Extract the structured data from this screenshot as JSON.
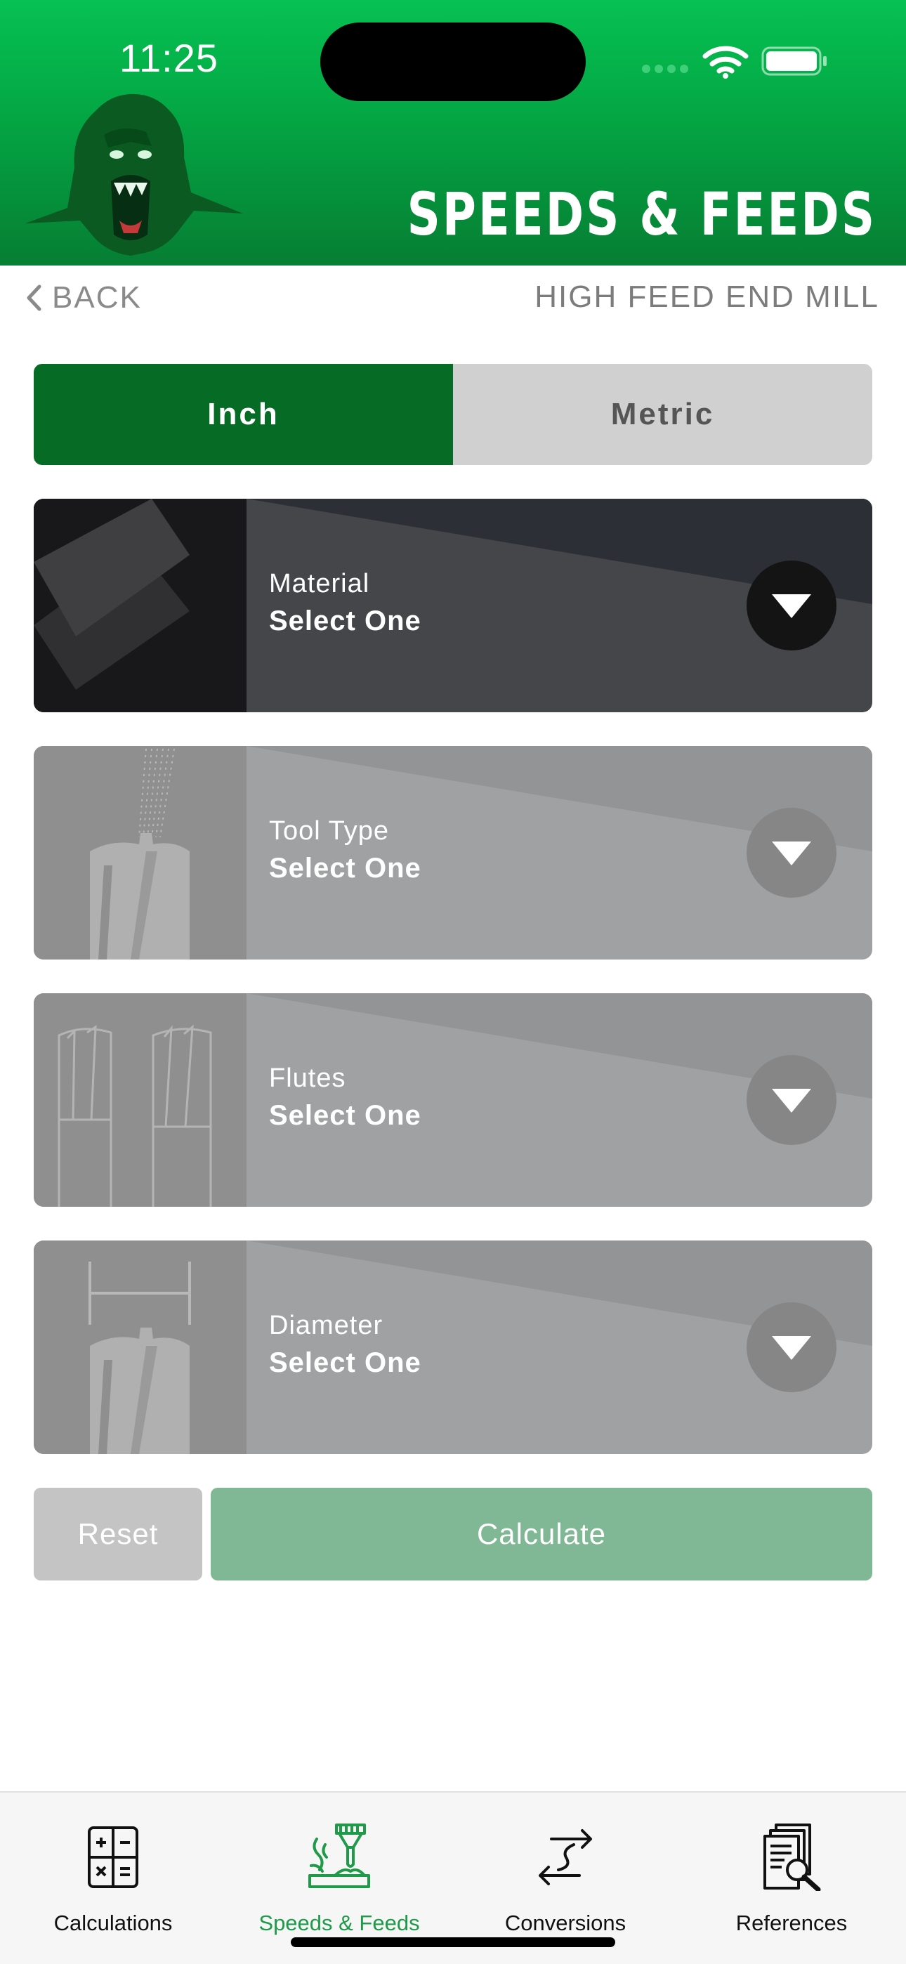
{
  "status": {
    "time": "11:25"
  },
  "header": {
    "title": "SPEEDS & FEEDS"
  },
  "nav": {
    "back_label": "BACK",
    "subtitle": "HIGH FEED END MILL"
  },
  "units": {
    "inch_label": "Inch",
    "metric_label": "Metric",
    "selected": "Inch"
  },
  "cards": [
    {
      "label": "Material",
      "value": "Select One",
      "state": "active"
    },
    {
      "label": "Tool Type",
      "value": "Select One",
      "state": "disabled"
    },
    {
      "label": "Flutes",
      "value": "Select One",
      "state": "disabled"
    },
    {
      "label": "Diameter",
      "value": "Select One",
      "state": "disabled"
    }
  ],
  "actions": {
    "reset_label": "Reset",
    "calculate_label": "Calculate"
  },
  "tabbar": {
    "items": [
      {
        "label": "Calculations",
        "icon": "calculator-icon"
      },
      {
        "label": "Speeds & Feeds",
        "icon": "milling-tool-icon",
        "selected": true
      },
      {
        "label": "Conversions",
        "icon": "convert-arrows-icon"
      },
      {
        "label": "References",
        "icon": "documents-search-icon"
      }
    ]
  },
  "colors": {
    "brand_green": "#066b24",
    "header_green": "#06c153",
    "active_tab": "#1e9a48",
    "calculate_disabled": "#80b794"
  }
}
